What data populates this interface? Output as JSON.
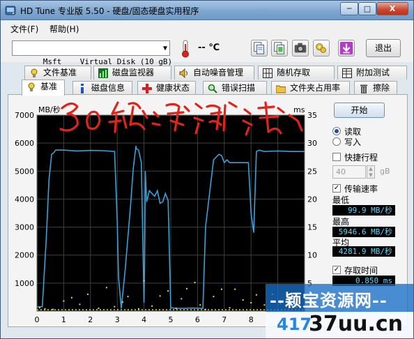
{
  "window": {
    "title": "HD Tune 专业版 5.50 - 硬盘/固态硬盘实用程序",
    "min_label": "─",
    "max_label": "□",
    "close_label": "X"
  },
  "menu": {
    "items": [
      "文件(F)",
      "帮助(H)"
    ]
  },
  "toolbar": {
    "drive": "Msft    Virtual Disk (10 gB)",
    "temperature": "-- ℃",
    "exit_label": "退出",
    "buttons": [
      "copy-info-icon",
      "copy-all-icon",
      "camera-icon",
      "options-icon",
      "save-down-icon"
    ]
  },
  "tabs": {
    "row1": [
      "文件基准",
      "磁盘监视器",
      "自动噪音管理",
      "随机存取",
      "附加测试"
    ],
    "row2": [
      "基准",
      "磁盘信息",
      "健康状态",
      "错误扫描",
      "文件夹占用率",
      "擦除"
    ],
    "active": "基准"
  },
  "chart_data": {
    "type": "line",
    "title": "",
    "xlabel": "",
    "ylabel_left": "MB/秒",
    "ylabel_right": "ms",
    "x_ticks": [
      "0",
      "1",
      "2",
      "3",
      "4",
      "5",
      "6",
      "7",
      "8"
    ],
    "xlim": [
      0,
      10
    ],
    "y_left_ticks": [
      "7000",
      "6000",
      "5000",
      "4000",
      "3000",
      "2000",
      "1000"
    ],
    "y_right_ticks": [
      "35",
      "30",
      "25",
      "20",
      "15",
      "10",
      "5"
    ],
    "ylim_left": [
      0,
      7000
    ],
    "ylim_right": [
      0,
      35
    ],
    "grid": true,
    "background": "#000000",
    "grid_color": "#3f3f3f",
    "series": [
      {
        "name": "传输速率",
        "color": "#3aa0d8",
        "x": [
          0,
          0.2,
          0.35,
          0.45,
          0.55,
          0.62,
          0.7,
          1.0,
          1.5,
          2.0,
          2.5,
          2.9,
          3.0,
          3.05,
          3.15,
          3.3,
          3.5,
          3.6,
          3.65,
          3.7,
          3.72,
          3.8,
          3.9,
          4.0,
          4.02,
          4.05,
          4.1,
          4.2,
          4.3,
          4.4,
          4.5,
          4.6,
          4.7,
          4.8,
          4.9,
          5.0,
          5.05,
          5.15,
          5.3,
          5.5,
          5.8,
          6.2,
          6.3,
          6.6,
          6.8,
          6.9,
          7.0,
          7.1,
          7.2,
          7.5,
          7.9,
          8.0,
          8.1,
          8.2,
          8.3,
          8.5,
          9.0,
          9.5,
          10.0
        ],
        "y": [
          150,
          160,
          2600,
          4700,
          5600,
          5650,
          5750,
          5750,
          5720,
          5740,
          5730,
          5700,
          3200,
          1200,
          100,
          1500,
          3800,
          5100,
          5500,
          5900,
          5800,
          5750,
          5300,
          300,
          1600,
          5000,
          3900,
          4300,
          4200,
          4100,
          4300,
          3850,
          3900,
          4200,
          3950,
          100,
          120,
          100,
          100,
          100,
          110,
          100,
          3000,
          5400,
          5600,
          5550,
          5300,
          5400,
          5300,
          5300,
          5300,
          3500,
          2800,
          5700,
          5750,
          5700,
          5720,
          5700,
          5700
        ]
      },
      {
        "name": "存取时间",
        "color": "#e0e040",
        "points": [
          [
            0.1,
            0.6
          ],
          [
            0.3,
            0.4
          ],
          [
            0.6,
            0.3
          ],
          [
            1.0,
            1.8
          ],
          [
            1.3,
            2.4
          ],
          [
            1.6,
            1.2
          ],
          [
            1.9,
            3.0
          ],
          [
            2.3,
            0.5
          ],
          [
            2.6,
            4.2
          ],
          [
            2.9,
            0.8
          ],
          [
            3.2,
            1.6
          ],
          [
            3.4,
            2.6
          ],
          [
            3.8,
            0.4
          ],
          [
            4.0,
            5.4
          ],
          [
            4.3,
            0.9
          ],
          [
            4.6,
            2.7
          ],
          [
            4.9,
            3.6
          ],
          [
            5.2,
            0.5
          ],
          [
            5.4,
            2.2
          ],
          [
            5.6,
            4.0
          ],
          [
            5.9,
            5.1
          ],
          [
            6.1,
            1.1
          ],
          [
            6.3,
            0.3
          ],
          [
            6.6,
            2.6
          ],
          [
            6.9,
            3.9
          ],
          [
            7.2,
            0.6
          ],
          [
            7.4,
            3.9
          ],
          [
            7.7,
            2.0
          ],
          [
            8.0,
            1.5
          ],
          [
            8.2,
            2.9
          ],
          [
            8.5,
            1.1
          ],
          [
            8.8,
            3.0
          ],
          [
            9.1,
            1.4
          ],
          [
            9.4,
            2.2
          ],
          [
            9.7,
            0.7
          ]
        ]
      }
    ]
  },
  "side": {
    "start_label": "开始",
    "read_label": "读取",
    "write_label": "写入",
    "read_selected": true,
    "quick_label": "快捷行程",
    "quick_checked": false,
    "blocksize_value": "40",
    "blocksize_unit": "gB",
    "transfer_label": "传输速率",
    "transfer_checked": true,
    "min_label": "最低",
    "min_value": "99.9 MB/秒",
    "max_label": "最高",
    "max_value": "5946.6 MB/秒",
    "avg_label": "平均",
    "avg_value": "4281.9 MB/秒",
    "access_label": "存取时间",
    "access_checked": true,
    "access_value": "0.850 ms"
  },
  "watermark": {
    "title": "--颖宝资源网--",
    "number": "417",
    "site": "37uu.cn"
  }
}
